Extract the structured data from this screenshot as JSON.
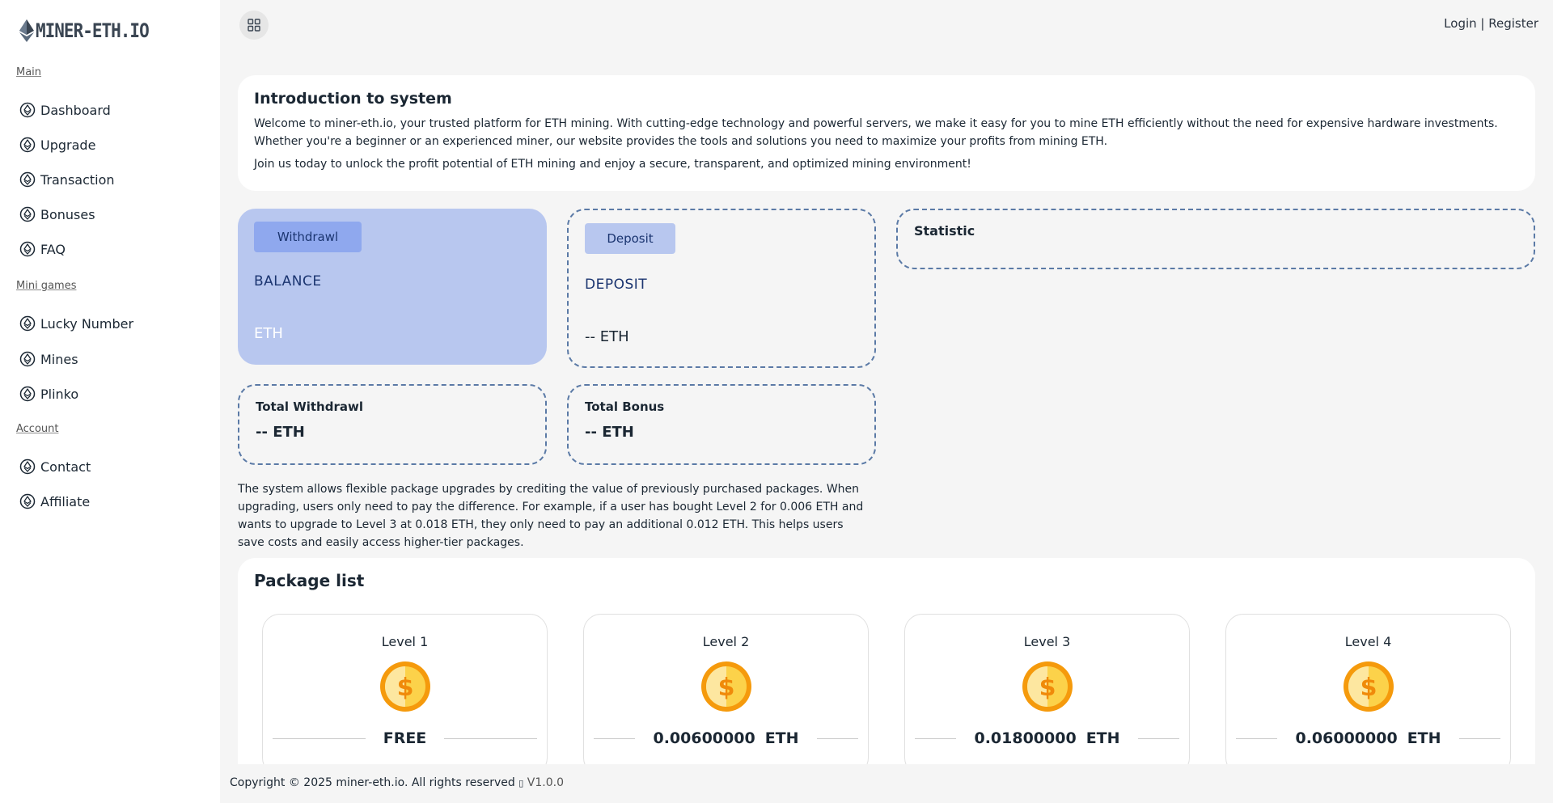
{
  "brand": {
    "name": "MINER-ETH.IO"
  },
  "sidebar": {
    "sections": [
      {
        "label": "Main",
        "items": [
          {
            "label": "Dashboard",
            "icon": "ethereum-circle-icon"
          },
          {
            "label": "Upgrade",
            "icon": "ethereum-circle-icon"
          },
          {
            "label": "Transaction",
            "icon": "ethereum-circle-icon"
          },
          {
            "label": "Bonuses",
            "icon": "ethereum-circle-icon"
          },
          {
            "label": "FAQ",
            "icon": "ethereum-circle-icon"
          }
        ]
      },
      {
        "label": "Mini games",
        "items": [
          {
            "label": "Lucky Number",
            "icon": "ethereum-circle-icon"
          },
          {
            "label": "Mines",
            "icon": "ethereum-circle-icon"
          },
          {
            "label": "Plinko",
            "icon": "ethereum-circle-icon"
          }
        ]
      },
      {
        "label": "Account",
        "items": [
          {
            "label": "Contact",
            "icon": "ethereum-circle-icon"
          },
          {
            "label": "Affiliate",
            "icon": "ethereum-circle-icon"
          }
        ]
      }
    ]
  },
  "topbar": {
    "menu_icon": "grid-icon",
    "login_label": "Login",
    "separator": " | ",
    "register_label": "Register"
  },
  "intro": {
    "title": "Introduction to system",
    "paragraph1": "Welcome to miner-eth.io, your trusted platform for ETH mining. With cutting-edge technology and powerful servers, we make it easy for you to mine ETH efficiently without the need for expensive hardware investments. Whether you're a beginner or an experienced miner, our website provides the tools and solutions you need to maximize your profits from mining ETH.",
    "paragraph2": "Join us today to unlock the profit potential of ETH mining and enjoy a secure, transparent, and optimized mining environment!"
  },
  "balance_card": {
    "button_label": "Withdrawl",
    "title": "BALANCE",
    "value": "ETH"
  },
  "deposit_card": {
    "button_label": "Deposit",
    "title": "DEPOSIT",
    "value": "-- ETH"
  },
  "statistic_card": {
    "title": "Statistic"
  },
  "total_withdrawl_card": {
    "title": "Total Withdrawl",
    "value": "-- ETH"
  },
  "total_bonus_card": {
    "title": "Total Bonus",
    "value": "-- ETH"
  },
  "description": "The system allows flexible package upgrades by crediting the value of previously purchased packages. When upgrading, users only need to pay the difference. For example, if a user has bought Level 2 for 0.006 ETH and wants to upgrade to Level 3 at 0.018 ETH, they only need to pay an additional 0.012 ETH. This helps users save costs and easily access higher-tier packages.",
  "packages": {
    "title": "Package list",
    "items": [
      {
        "level": "Level 1",
        "price": "FREE",
        "unit": ""
      },
      {
        "level": "Level 2",
        "price": "0.00600000",
        "unit": "ETH"
      },
      {
        "level": "Level 3",
        "price": "0.01800000",
        "unit": "ETH"
      },
      {
        "level": "Level 4",
        "price": "0.06000000",
        "unit": "ETH"
      }
    ]
  },
  "footer": {
    "copyright": "Copyright © 2025 miner-eth.io. All rights reserved",
    "glyph": "▯",
    "version": "V1.0.0"
  },
  "colors": {
    "accent": "#8fa8ee",
    "balance_card_bg": "#b8c7ef",
    "dashed_border": "#5b7aa6",
    "coin_gold": "#f7b500"
  }
}
